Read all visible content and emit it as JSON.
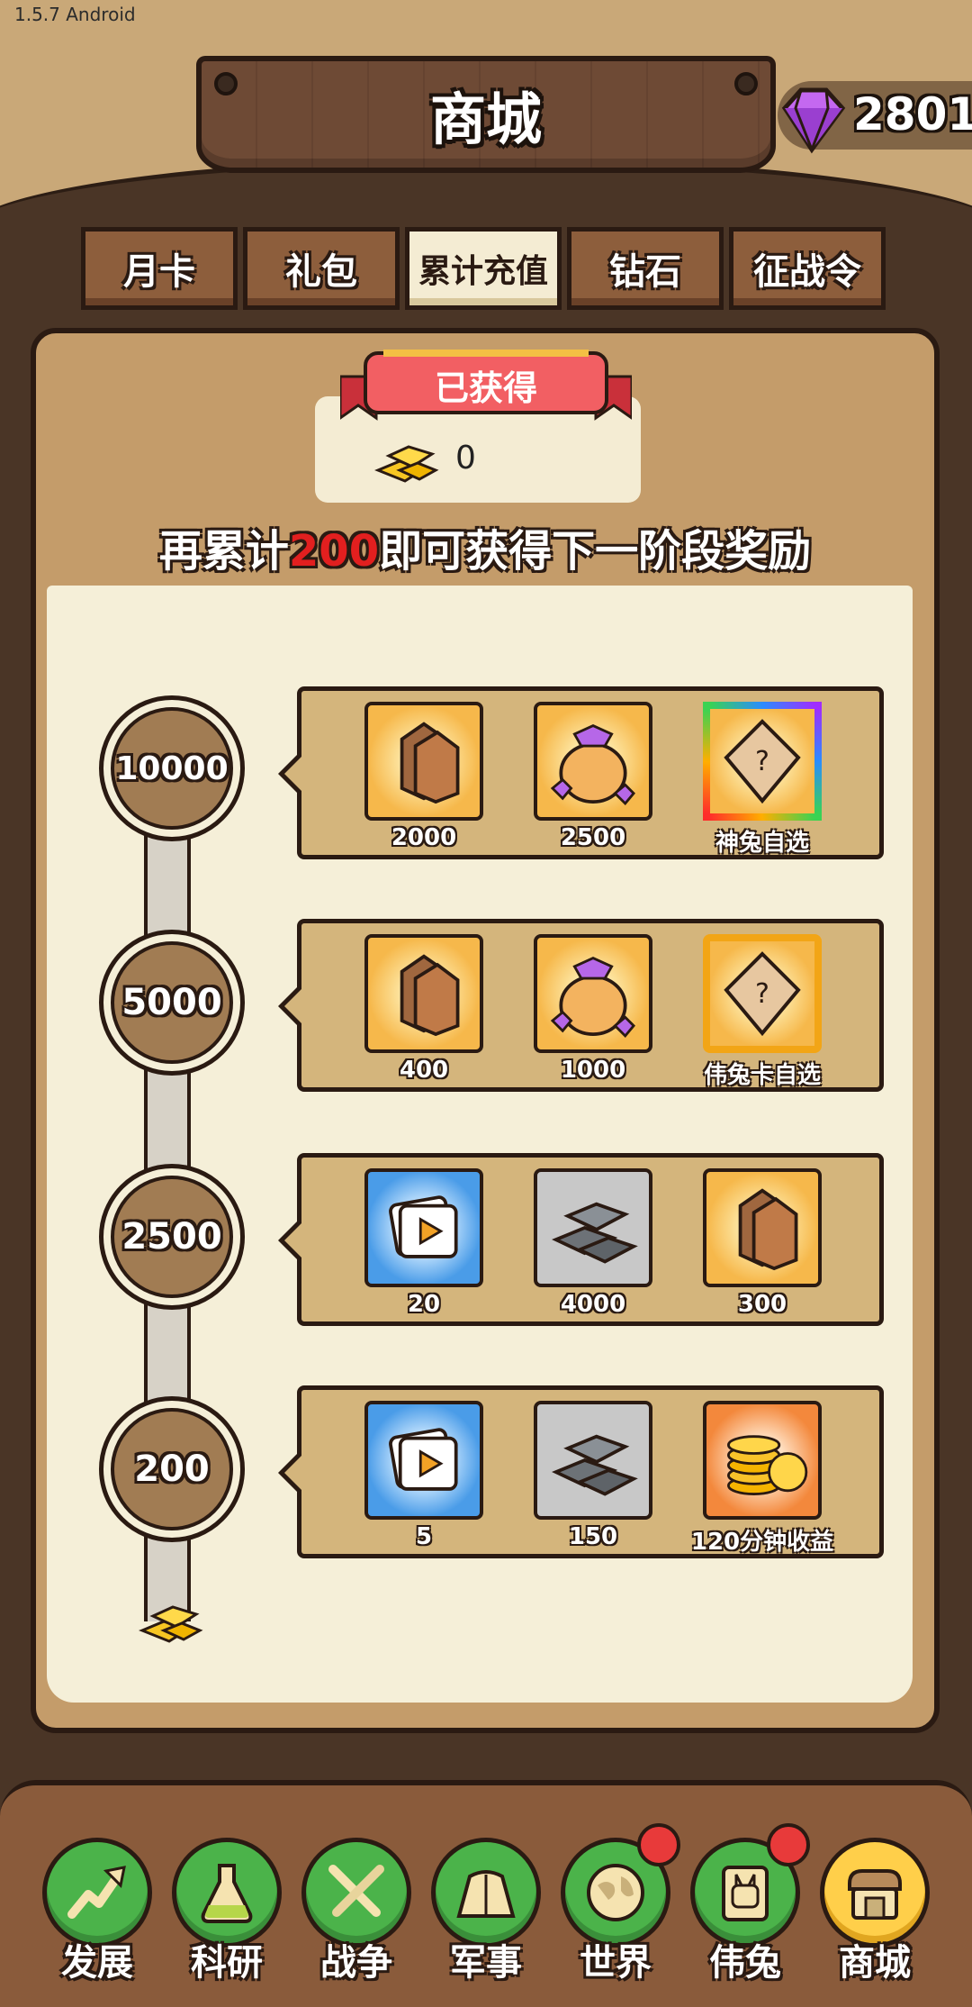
{
  "status_bar": {
    "version": "1.5.7 Android"
  },
  "header": {
    "title": "商城",
    "gems": "2801"
  },
  "tabs": [
    {
      "label": "月卡",
      "active": false
    },
    {
      "label": "礼包",
      "active": false
    },
    {
      "label": "累计充值",
      "active": true
    },
    {
      "label": "钻石",
      "active": false
    },
    {
      "label": "征战令",
      "active": false
    }
  ],
  "summary": {
    "obtained_label": "已获得",
    "obtained_value": "0",
    "hint_prefix": "再累计",
    "hint_amount": "200",
    "hint_suffix": "即可获得下一阶段奖励"
  },
  "tiers": [
    {
      "threshold": "10000",
      "rewards": [
        {
          "icon": "card-pack-icon",
          "label": "2000"
        },
        {
          "icon": "gem-bag-icon",
          "label": "2500"
        },
        {
          "icon": "mystery-card-rainbow-icon",
          "label": "神兔自选"
        }
      ]
    },
    {
      "threshold": "5000",
      "rewards": [
        {
          "icon": "card-pack-icon",
          "label": "400"
        },
        {
          "icon": "gem-bag-icon",
          "label": "1000"
        },
        {
          "icon": "mystery-card-gold-icon",
          "label": "伟兔卡自选"
        }
      ]
    },
    {
      "threshold": "2500",
      "rewards": [
        {
          "icon": "video-ticket-icon",
          "label": "20"
        },
        {
          "icon": "iron-ingot-icon",
          "label": "4000"
        },
        {
          "icon": "card-pack-icon",
          "label": "300"
        }
      ]
    },
    {
      "threshold": "200",
      "rewards": [
        {
          "icon": "video-ticket-icon",
          "label": "5"
        },
        {
          "icon": "iron-ingot-icon",
          "label": "150"
        },
        {
          "icon": "gold-coins-icon",
          "label": "120分钟收益"
        }
      ]
    }
  ],
  "nav": [
    {
      "label": "发展",
      "icon": "arrow-up-icon",
      "badge": false,
      "active": false
    },
    {
      "label": "科研",
      "icon": "flask-icon",
      "badge": false,
      "active": false
    },
    {
      "label": "战争",
      "icon": "crossed-swords-icon",
      "badge": false,
      "active": false
    },
    {
      "label": "军事",
      "icon": "tent-icon",
      "badge": false,
      "active": false
    },
    {
      "label": "世界",
      "icon": "globe-icon",
      "badge": true,
      "active": false
    },
    {
      "label": "伟兔",
      "icon": "rabbit-card-icon",
      "badge": true,
      "active": false
    },
    {
      "label": "商城",
      "icon": "shop-icon",
      "badge": false,
      "active": true
    }
  ],
  "colors": {
    "accent_red": "#e21f1f",
    "nav_green": "#4bb34a",
    "nav_active": "#ffcf4a"
  }
}
